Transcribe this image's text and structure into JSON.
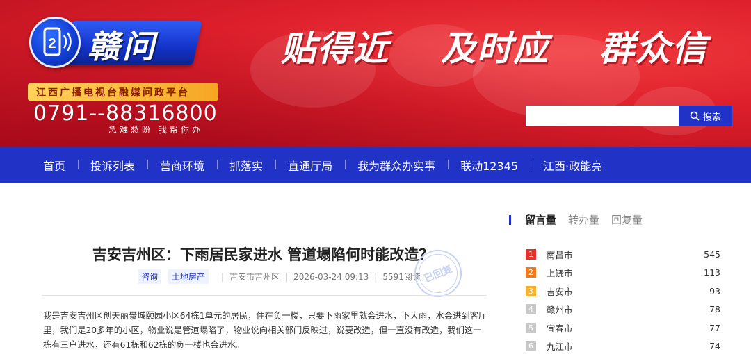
{
  "header": {
    "logo_badge": "2",
    "logo_name": "赣问",
    "slogan": "江西广播电视台融媒问政平台",
    "hotline": "0791--88316800",
    "hotline_sub": "急难愁盼   我帮你办",
    "motto": [
      "贴得近",
      "及时应",
      "群众信"
    ],
    "search": {
      "placeholder": "",
      "button_label": "搜索",
      "icon": "search-icon"
    }
  },
  "nav": [
    "首页",
    "投诉列表",
    "营商环境",
    "抓落实",
    "直通厅局",
    "我为群众办实事",
    "联动12345",
    "江西·政能亮"
  ],
  "article": {
    "title": "吉安吉州区：下雨居民家进水 管道塌陷何时能改造？",
    "tags": [
      "咨询",
      "土地房产"
    ],
    "region": "吉安市吉州区",
    "datetime": "2026-03-24 09:13",
    "reads": "5591阅读",
    "stamp": "已回复",
    "body": "我是吉安吉州区创天丽景城颐园小区64栋1单元的居民，住在负一楼，只要下雨家里就会进水，下大雨，水会进到客厅里，我们是20多年的小区，物业说是管道塌陷了，物业说向相关部门反映过，说要改造，但一直没有改造，我们这一栋有三户进水，还有61栋和62栋的负一楼也会进水。"
  },
  "sidebar": {
    "tabs": [
      "留言量",
      "转办量",
      "回复量"
    ],
    "active_tab": "留言量",
    "ranking": [
      {
        "rank": "1",
        "city": "南昌市",
        "count": "545",
        "color": "#e4322b"
      },
      {
        "rank": "2",
        "city": "上饶市",
        "count": "113",
        "color": "#f07a20"
      },
      {
        "rank": "3",
        "city": "吉安市",
        "count": "93",
        "color": "#f5b335"
      },
      {
        "rank": "4",
        "city": "赣州市",
        "count": "78",
        "color": "#c9c9c9"
      },
      {
        "rank": "5",
        "city": "宜春市",
        "count": "77",
        "color": "#c9c9c9"
      },
      {
        "rank": "6",
        "city": "九江市",
        "count": "74",
        "color": "#c9c9c9"
      }
    ]
  },
  "colors": {
    "banner_red": "#dd1f2b",
    "nav_blue": "#2132c6",
    "slogan_gold": "#f5a623"
  }
}
